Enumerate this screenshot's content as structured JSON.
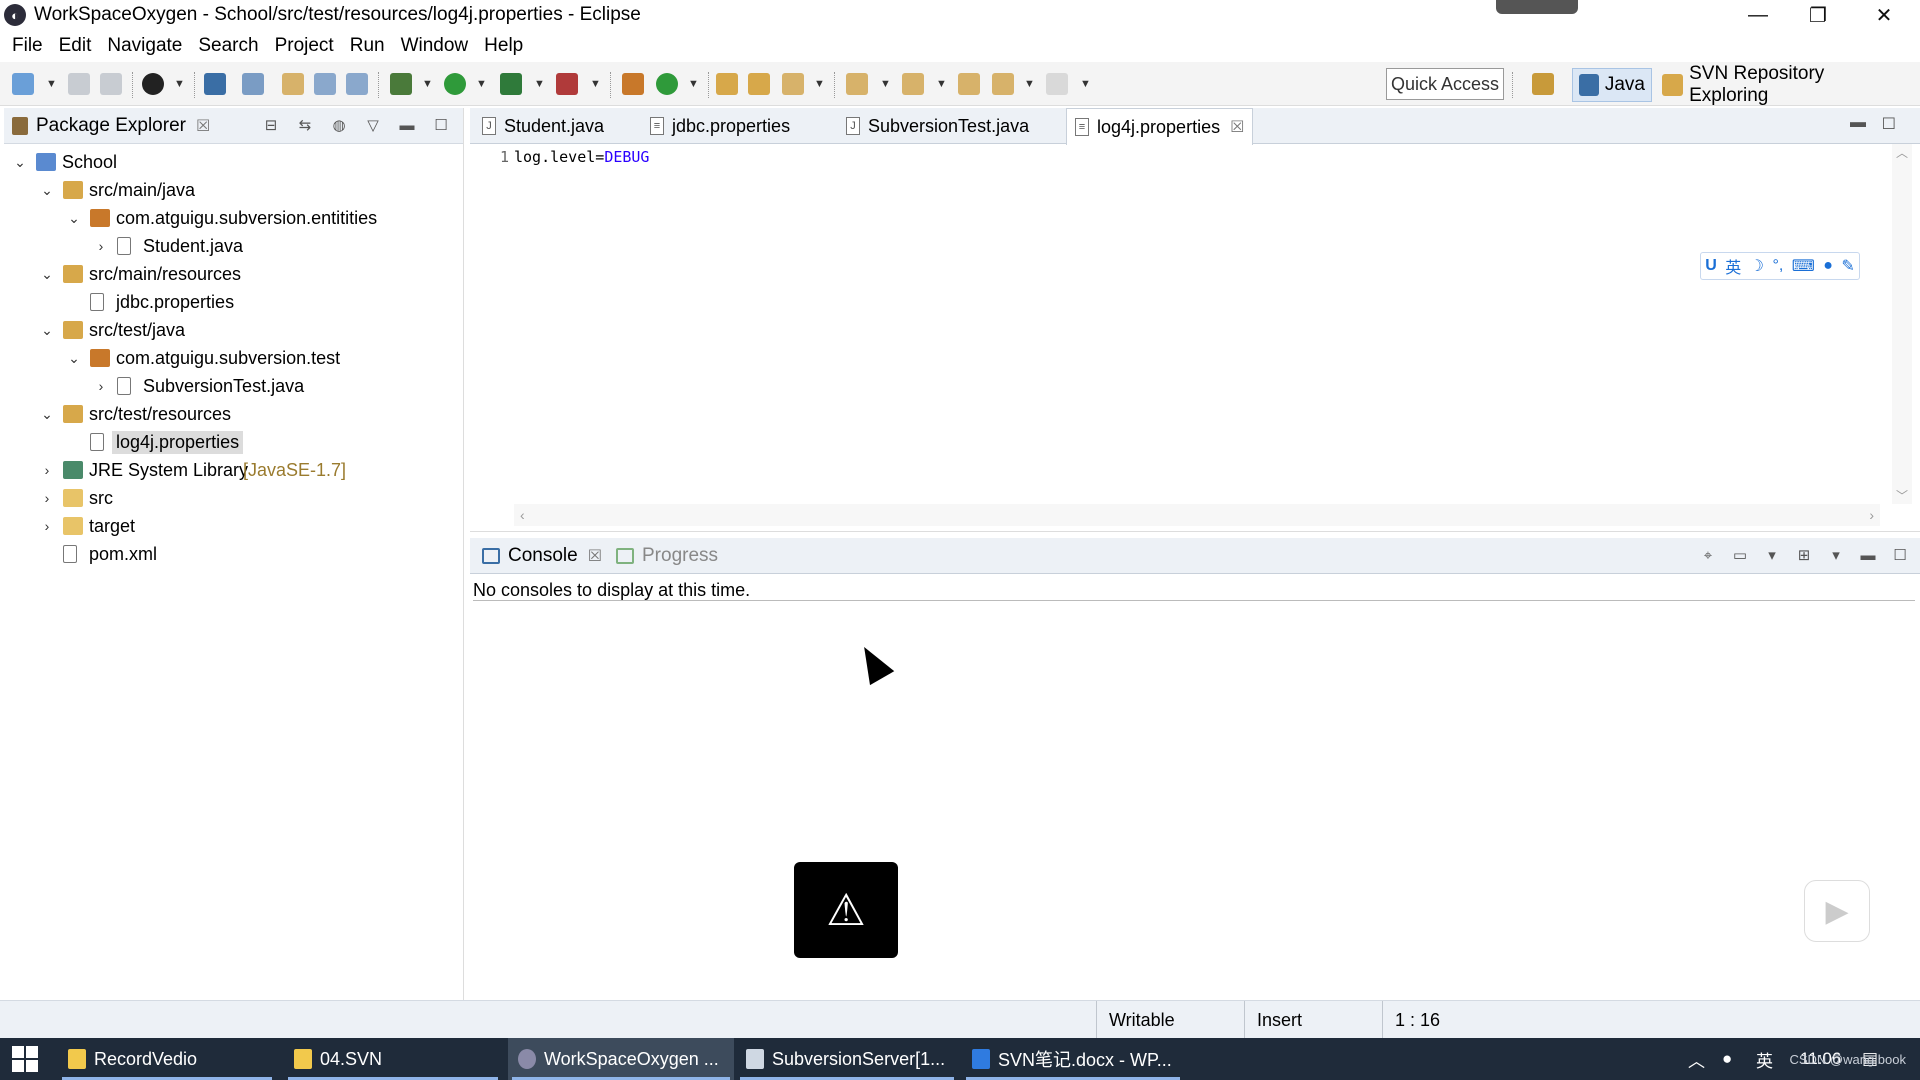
{
  "window": {
    "title": "WorkSpaceOxygen - School/src/test/resources/log4j.properties - Eclipse",
    "minimize": "—",
    "restore": "❐",
    "close": "✕"
  },
  "menu": [
    "File",
    "Edit",
    "Navigate",
    "Search",
    "Project",
    "Run",
    "Window",
    "Help"
  ],
  "toolbar": {
    "quick_access": "Quick Access",
    "perspectives": [
      {
        "label": "Java",
        "active": true
      },
      {
        "label": "SVN Repository Exploring",
        "active": false
      }
    ]
  },
  "package_explorer": {
    "tab_label": "Package Explorer",
    "tree": [
      {
        "label": "School",
        "depth": 0,
        "expanded": true,
        "icon": "project-icon"
      },
      {
        "label": "src/main/java",
        "depth": 1,
        "expanded": true,
        "icon": "source-folder-icon"
      },
      {
        "label": "com.atguigu.subversion.entitities",
        "depth": 2,
        "expanded": true,
        "icon": "package-icon"
      },
      {
        "label": "Student.java",
        "depth": 3,
        "expanded": false,
        "icon": "java-file-icon"
      },
      {
        "label": "src/main/resources",
        "depth": 1,
        "expanded": true,
        "icon": "source-folder-icon"
      },
      {
        "label": "jdbc.properties",
        "depth": 2,
        "expanded": null,
        "icon": "properties-file-icon"
      },
      {
        "label": "src/test/java",
        "depth": 1,
        "expanded": true,
        "icon": "source-folder-icon"
      },
      {
        "label": "com.atguigu.subversion.test",
        "depth": 2,
        "expanded": true,
        "icon": "package-icon"
      },
      {
        "label": "SubversionTest.java",
        "depth": 3,
        "expanded": false,
        "icon": "java-file-icon"
      },
      {
        "label": "src/test/resources",
        "depth": 1,
        "expanded": true,
        "icon": "source-folder-icon"
      },
      {
        "label": "log4j.properties",
        "depth": 2,
        "expanded": null,
        "icon": "properties-file-icon",
        "selected": true
      },
      {
        "label": "JRE System Library",
        "suffix": "[JavaSE-1.7]",
        "depth": 1,
        "expanded": false,
        "icon": "library-icon"
      },
      {
        "label": "src",
        "depth": 1,
        "expanded": false,
        "icon": "folder-icon"
      },
      {
        "label": "target",
        "depth": 1,
        "expanded": false,
        "icon": "folder-icon"
      },
      {
        "label": "pom.xml",
        "depth": 1,
        "expanded": null,
        "icon": "xml-file-icon"
      }
    ]
  },
  "editor": {
    "tabs": [
      {
        "label": "Student.java",
        "icon": "java-file-icon",
        "active": false
      },
      {
        "label": "jdbc.properties",
        "icon": "properties-file-icon",
        "active": false
      },
      {
        "label": "SubversionTest.java",
        "icon": "java-file-icon",
        "active": false
      },
      {
        "label": "log4j.properties",
        "icon": "properties-file-icon",
        "active": true
      }
    ],
    "line_number": "1",
    "code_key": "log.level=",
    "code_value": "DEBUG",
    "ime_items": [
      "英",
      "☽",
      "°,",
      "⌨",
      "●",
      "✎"
    ]
  },
  "console": {
    "tabs": [
      {
        "label": "Console",
        "active": true
      },
      {
        "label": "Progress",
        "active": false
      }
    ],
    "message": "No consoles to display at this time."
  },
  "status": {
    "writable": "Writable",
    "insert": "Insert",
    "position": "1 : 16"
  },
  "taskbar": {
    "items": [
      {
        "label": "RecordVedio",
        "active": false
      },
      {
        "label": "04.SVN",
        "active": false
      },
      {
        "label": "WorkSpaceOxygen ...",
        "active": true
      },
      {
        "label": "SubversionServer[1...",
        "active": false
      },
      {
        "label": "SVN笔记.docx - WP...",
        "active": false
      }
    ],
    "tray_lang": "英",
    "clock": "11:06"
  },
  "watermark": "CSDN @wang book",
  "colors": {
    "tab_bar": "#edf1f6",
    "selection": "#dcdcdc",
    "taskbar": "#1f2b3a",
    "code_value": "#2a00ff"
  }
}
